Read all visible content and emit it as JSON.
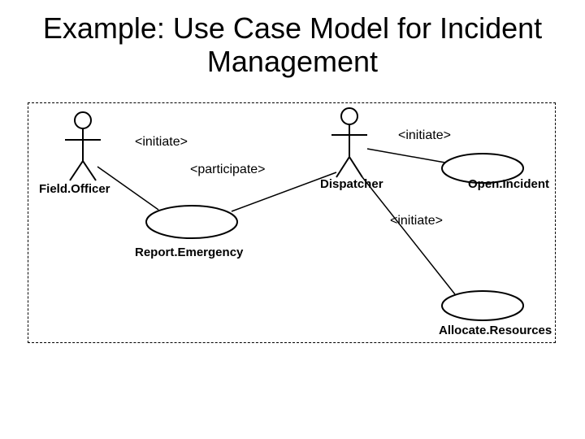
{
  "title": "Example:  Use Case Model for Incident Management",
  "actors": {
    "fieldOfficer": "Field.Officer",
    "dispatcher": "Dispatcher"
  },
  "relations": {
    "initiate1": "<initiate>",
    "initiate2": "<initiate>",
    "initiate3": "<initiate>",
    "participate": "<participate>"
  },
  "usecases": {
    "reportEmergency": "Report.Emergency",
    "openIncident": "Open.Incident",
    "allocateResources": "Allocate.Resources"
  }
}
